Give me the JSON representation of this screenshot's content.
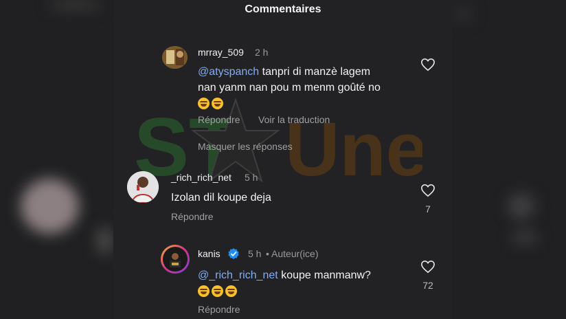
{
  "header": {
    "title": "Commentaires"
  },
  "watermark": {
    "text_star": "ST",
    "text_une": "Une"
  },
  "comments": [
    {
      "username": "mrray_509",
      "time": "2 h",
      "mention": "@atyspanch",
      "text_line1": " tanpri di manzè lagem",
      "text_line2": "nan yanm nan pou m menm goûté no",
      "emoji_count": 2,
      "reply_label": "Répondre",
      "translate_label": "Voir la traduction",
      "hide_replies_label": "Masquer les réponses",
      "likes": ""
    },
    {
      "username": "_rich_rich_net",
      "time": "5 h",
      "text": "Izolan dil koupe deja",
      "reply_label": "Répondre",
      "likes": "7"
    },
    {
      "username": "kanis",
      "time": "5 h",
      "author_badge": "• Auteur(ice)",
      "mention": "@_rich_rich_net",
      "text": " koupe manmanw?",
      "emoji_count": 3,
      "reply_label": "Répondre",
      "likes": "72"
    }
  ],
  "colors": {
    "mention": "#82aef3",
    "verified": "#1f8cf0",
    "background": "#222224"
  },
  "icons": [
    "heart-outline-icon",
    "verified-badge-icon"
  ]
}
